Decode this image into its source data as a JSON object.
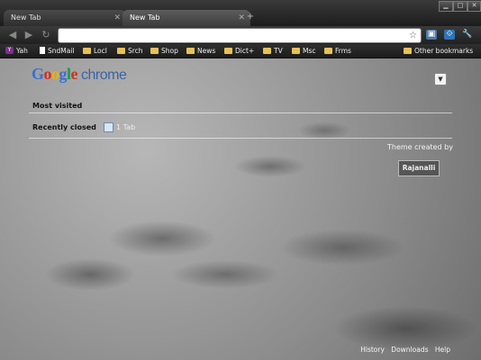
{
  "tabs": [
    {
      "label": "New Tab",
      "active": false
    },
    {
      "label": "New Tab",
      "active": true
    }
  ],
  "window_controls": [
    "minimize",
    "maximize",
    "close"
  ],
  "toolbar": {
    "address_value": "",
    "icons": [
      "back-icon",
      "forward-icon",
      "reload-icon",
      "star-icon",
      "extension-icon",
      "extension-icon-2",
      "wrench-icon"
    ]
  },
  "bookmarks": {
    "items": [
      {
        "label": "Yah",
        "icon": "yahoo-icon"
      },
      {
        "label": "SndMail",
        "icon": "page-icon"
      },
      {
        "label": "Locl",
        "icon": "folder-icon"
      },
      {
        "label": "Srch",
        "icon": "folder-icon"
      },
      {
        "label": "Shop",
        "icon": "folder-icon"
      },
      {
        "label": "News",
        "icon": "folder-icon"
      },
      {
        "label": "Dict+",
        "icon": "folder-icon"
      },
      {
        "label": "TV",
        "icon": "folder-icon"
      },
      {
        "label": "Msc",
        "icon": "folder-icon"
      },
      {
        "label": "Frms",
        "icon": "folder-icon"
      }
    ],
    "other": "Other bookmarks"
  },
  "ntp": {
    "logo_text": "Google",
    "logo_product": "chrome",
    "most_visited": "Most visited",
    "recently_closed": "Recently closed",
    "recent_item": "1 Tab",
    "theme_credit": "Theme created by",
    "theme_author": "Rajanalli",
    "footer": {
      "history": "History",
      "downloads": "Downloads",
      "help": "Help"
    }
  }
}
